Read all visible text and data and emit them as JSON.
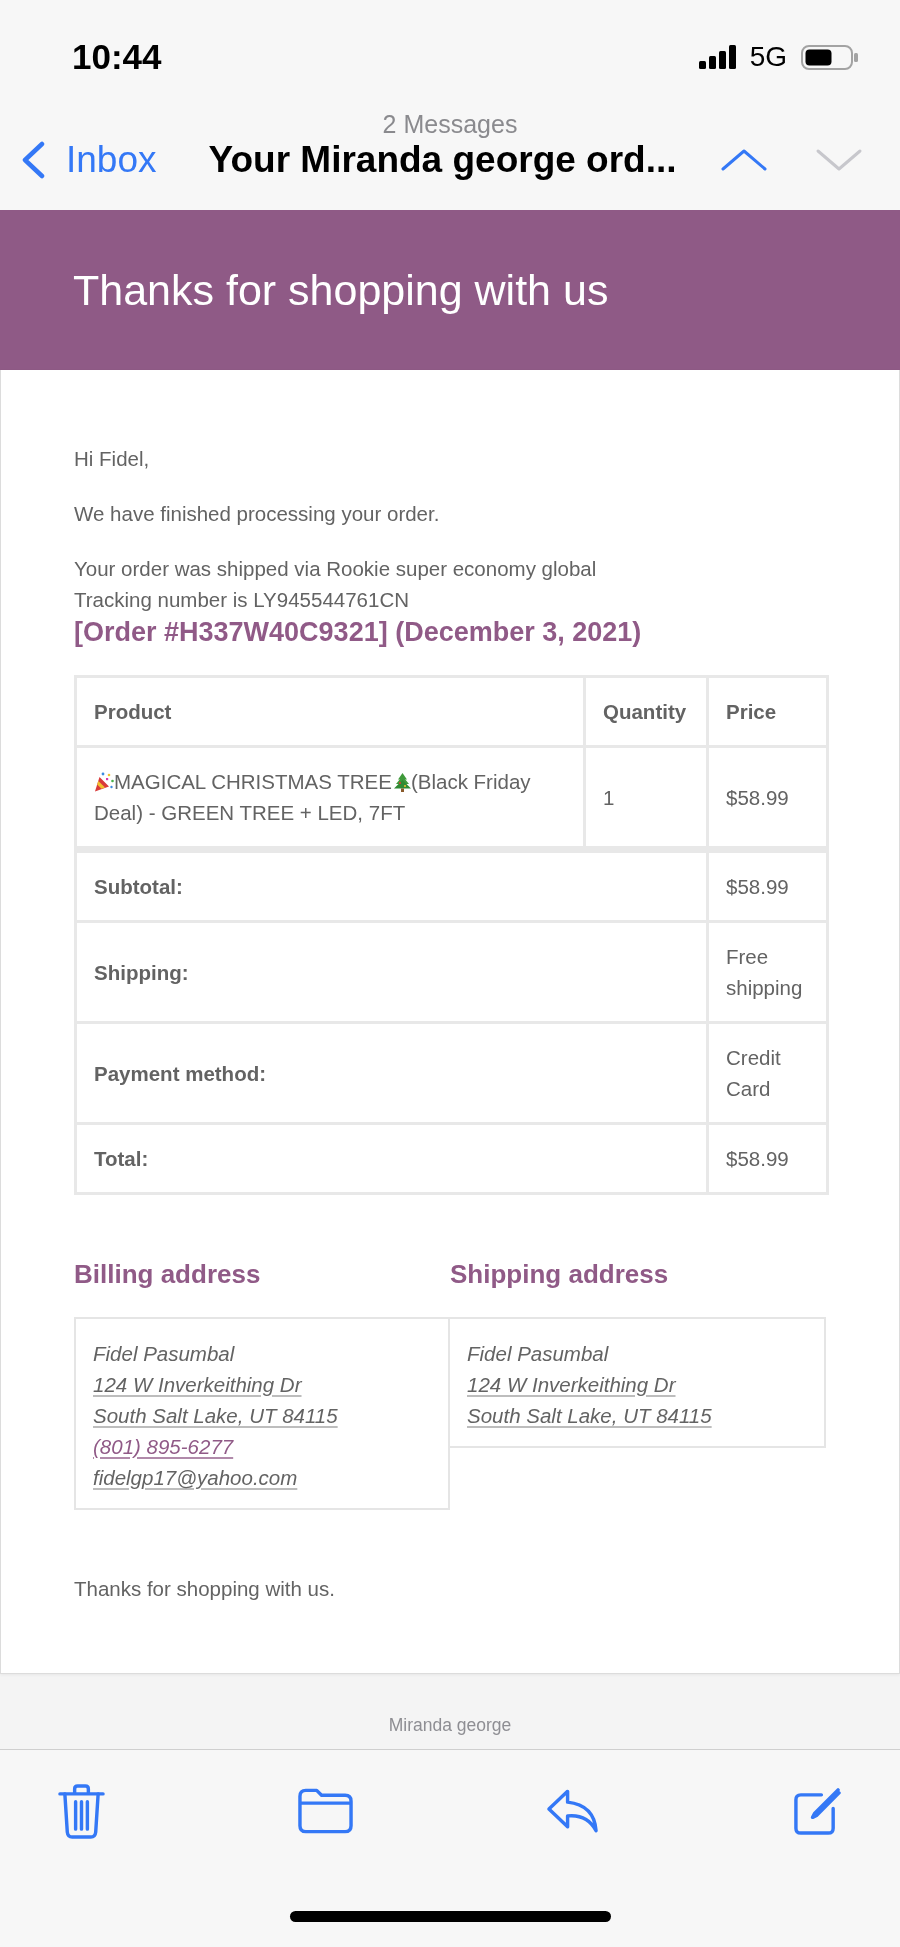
{
  "status_bar": {
    "time": "10:44",
    "network": "5G"
  },
  "nav": {
    "message_count": "2 Messages",
    "back_label": "Inbox",
    "subject": "Your Miranda george ord...",
    "previous_button": {
      "disabled": false
    },
    "next_button": {
      "disabled": true
    }
  },
  "email_header": {
    "title": "Thanks for shopping with us"
  },
  "email_body": {
    "greeting": "Hi Fidel,",
    "paragraphs": [
      {
        "lines": [
          "We have finished processing your order."
        ]
      },
      {
        "lines": [
          "Your order was shipped via Rookie super economy global",
          "Tracking number is LY945544761CN"
        ]
      }
    ],
    "order_heading": "[Order #H337W40C9321] (December 3, 2021)",
    "order_table": {
      "columns": [
        "Product",
        "Quantity",
        "Price"
      ],
      "items": [
        {
          "name_segments": [
            "MAGICAL CHRISTMAS TREE",
            "(Black Friday",
            "Deal) - GREEN TREE + LED, 7FT"
          ],
          "quantity": "1",
          "price": "$58.99"
        }
      ],
      "totals": [
        {
          "label": "Subtotal:",
          "value": "$58.99"
        },
        {
          "label": "Shipping:",
          "value": "Free shipping"
        },
        {
          "label": "Payment method:",
          "value": "Credit Card"
        },
        {
          "label": "Total:",
          "value": "$58.99"
        }
      ]
    },
    "addresses": [
      {
        "heading": "Billing address",
        "lines": [
          {
            "kind": "name",
            "text": "Fidel Pasumbal"
          },
          {
            "kind": "address",
            "text": "124 W Inverkeithing Dr"
          },
          {
            "kind": "address",
            "text": "South Salt Lake, UT 84115"
          },
          {
            "kind": "phone",
            "text": "(801) 895-6277"
          },
          {
            "kind": "email",
            "text": "fidelgp17@yahoo.com"
          }
        ]
      },
      {
        "heading": "Shipping address",
        "lines": [
          {
            "kind": "name",
            "text": "Fidel Pasumbal"
          },
          {
            "kind": "address",
            "text": "124 W Inverkeithing Dr"
          },
          {
            "kind": "address",
            "text": "South Salt Lake, UT 84115"
          }
        ]
      }
    ],
    "closing": "Thanks for shopping with us."
  },
  "footer": {
    "sender": "Miranda george"
  }
}
